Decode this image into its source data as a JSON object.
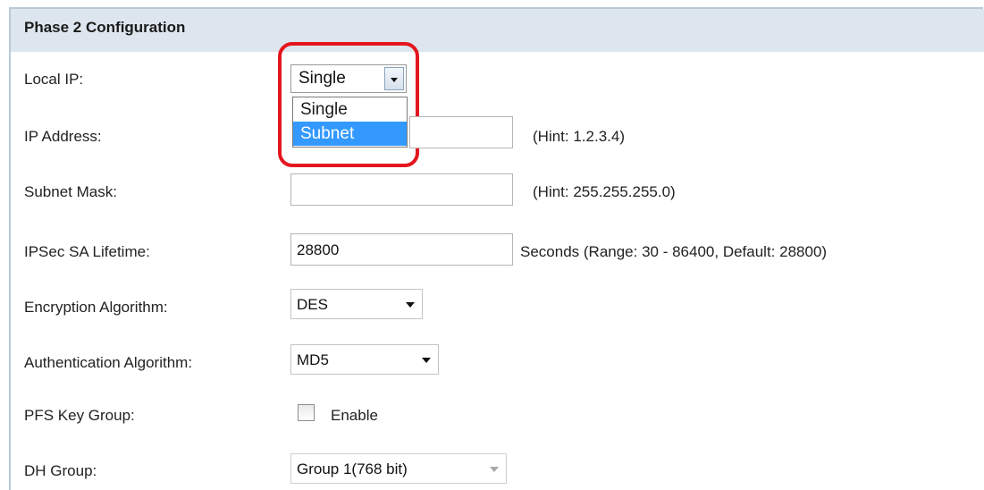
{
  "section_title": "Phase 2 Configuration",
  "local_ip": {
    "label": "Local IP:",
    "selected": "Single",
    "options": [
      "Single",
      "Subnet"
    ],
    "highlighted_option": "Subnet"
  },
  "ip_address": {
    "label": "IP Address:",
    "value": "",
    "hint": "(Hint: 1.2.3.4)"
  },
  "subnet_mask": {
    "label": "Subnet Mask:",
    "value": "",
    "hint": "(Hint: 255.255.255.0)"
  },
  "ipsec_sa_lifetime": {
    "label": "IPSec SA Lifetime:",
    "value": "28800",
    "hint": "Seconds  (Range: 30 - 86400, Default: 28800)"
  },
  "encryption_algorithm": {
    "label": "Encryption Algorithm:",
    "selected": "DES"
  },
  "authentication_algorithm": {
    "label": "Authentication Algorithm:",
    "selected": "MD5"
  },
  "pfs_key_group": {
    "label": "PFS Key Group:",
    "checkbox_label": "Enable",
    "checked": false
  },
  "dh_group": {
    "label": "DH Group:",
    "selected": "Group 1(768 bit)",
    "disabled": true
  },
  "colors": {
    "header_bg": "#dde6ee",
    "highlight_red": "#e4161f",
    "option_selected_bg": "#3399ff"
  }
}
